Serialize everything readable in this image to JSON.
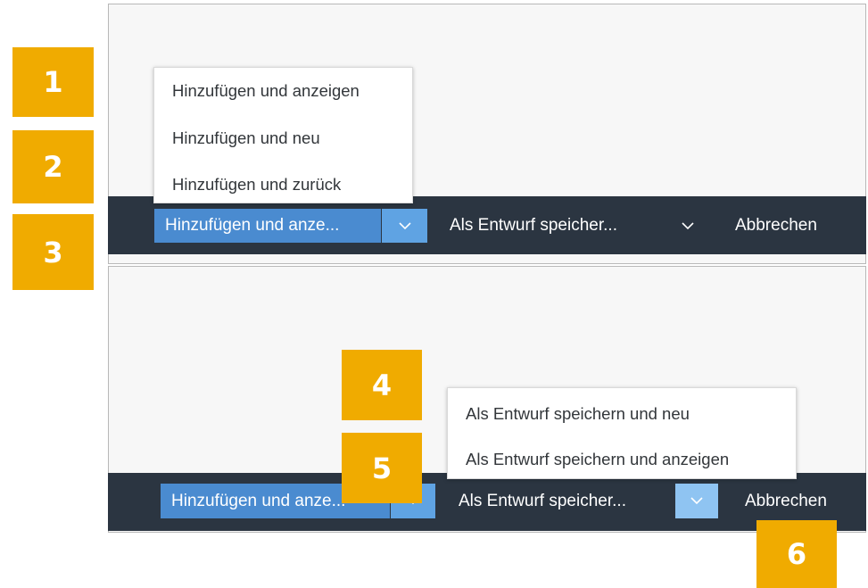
{
  "top": {
    "menu_items": [
      "Hinzufügen und anzeigen",
      "Hinzufügen und neu",
      "Hinzufügen und zurück"
    ],
    "add_label": "Hinzufügen und anze...",
    "draft_label": "Als Entwurf speicher...",
    "cancel_label": "Abbrechen"
  },
  "bottom": {
    "menu_items": [
      "Als Entwurf speichern und neu",
      "Als Entwurf speichern und anzeigen"
    ],
    "add_label": "Hinzufügen und anze...",
    "draft_label": "Als Entwurf speicher...",
    "cancel_label": "Abbrechen"
  },
  "badges": [
    "1",
    "2",
    "3",
    "4",
    "5",
    "6"
  ],
  "icons": {
    "dropdown": "chevron-down-icon"
  },
  "colors": {
    "badge": "#f0ab00",
    "toolbar": "#2b3541",
    "primary_button": "#4a8bd0",
    "arrow_button": "#5fa3e3"
  }
}
